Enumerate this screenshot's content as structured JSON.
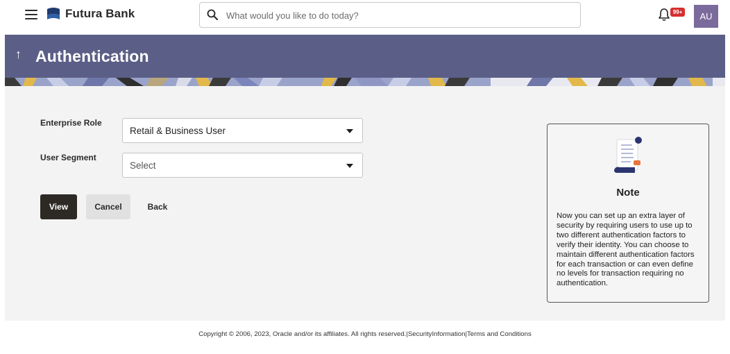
{
  "header": {
    "brand": "Futura Bank",
    "search_placeholder": "What would you like to do today?",
    "notification_badge": "99+",
    "avatar_initials": "AU"
  },
  "banner": {
    "back_arrow": "↑",
    "title": "Authentication"
  },
  "form": {
    "enterprise_role": {
      "label": "Enterprise Role",
      "value": "Retail & Business User"
    },
    "user_segment": {
      "label": "User Segment",
      "value": "Select"
    },
    "buttons": {
      "view": "View",
      "cancel": "Cancel",
      "back": "Back"
    }
  },
  "note": {
    "title": "Note",
    "body": "Now you can set up an extra layer of security by requiring users to use up to two different authentication factors to verify their identity. You can choose to maintain different authentication factors for each transaction or can even define no levels for transaction requiring no authentication."
  },
  "footer": {
    "copyright": "Copyright © 2006, 2023, Oracle and/or its affiliates. All rights reserved.",
    "separator": "|",
    "security_link": "SecurityInformation",
    "terms_link": "Terms and Conditions"
  },
  "colors": {
    "banner": "#5b5e86",
    "primary_button": "#2d2a26",
    "badge": "#d62f2f",
    "avatar": "#7b6a9c",
    "panel": "#f3f3f3"
  },
  "icons": [
    "hamburger-menu-icon",
    "futura-bank-logo",
    "search-icon",
    "bell-icon",
    "note-document-icon"
  ]
}
